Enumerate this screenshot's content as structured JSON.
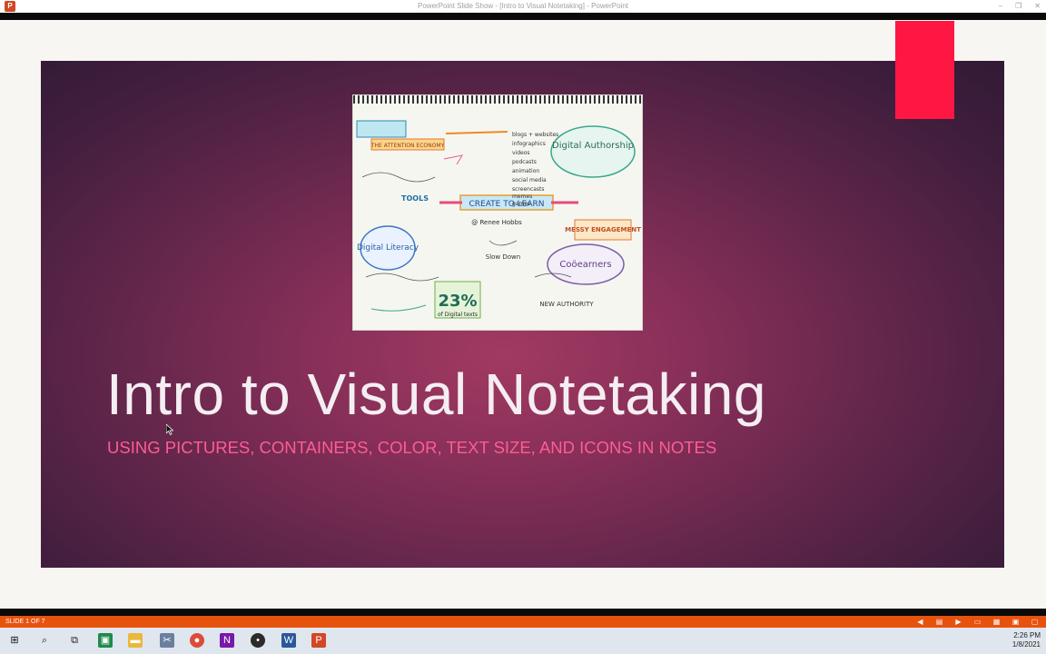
{
  "window": {
    "title": "PowerPoint Slide Show - [Intro to Visual Notetaking] - PowerPoint",
    "controls": [
      "–",
      "❐",
      "✕"
    ]
  },
  "slide": {
    "title": "Intro to Visual Notetaking",
    "subtitle": "USING PICTURES, CONTAINERS, COLOR, TEXT SIZE, AND ICONS IN NOTES",
    "image": {
      "texts": [
        "Digital Authorship",
        "CREATE TO LEARN",
        "Digital Literacy",
        "Coöearners",
        "THE ATTENTION ECONOMY",
        "23%",
        "of Digital texts",
        "@ Renee Hobbs",
        "blogs + websites",
        "infographics",
        "videos",
        "podcasts",
        "animation",
        "social media",
        "screencasts",
        "memes",
        "games",
        "MESSY ENGAGEMENT",
        "Slow Down",
        "NEW AUTHORITY",
        "TOOLS"
      ]
    },
    "accent_color": "#ff1744"
  },
  "presenter_bar": {
    "slide_indicator": "SLIDE 1 OF 7",
    "icons": [
      "previous-icon",
      "notes-icon",
      "play-icon",
      "normal-view-icon",
      "slide-sorter-icon",
      "reading-view-icon",
      "slideshow-icon"
    ]
  },
  "taskbar": {
    "time": "2:26 PM",
    "date": "1/8/2021",
    "apps": [
      "start-icon",
      "search-icon",
      "task-view-icon",
      "store-icon",
      "file-explorer-icon",
      "snip-icon",
      "chrome-icon",
      "onenote-icon",
      "messenger-icon",
      "word-icon",
      "powerpoint-icon"
    ]
  }
}
